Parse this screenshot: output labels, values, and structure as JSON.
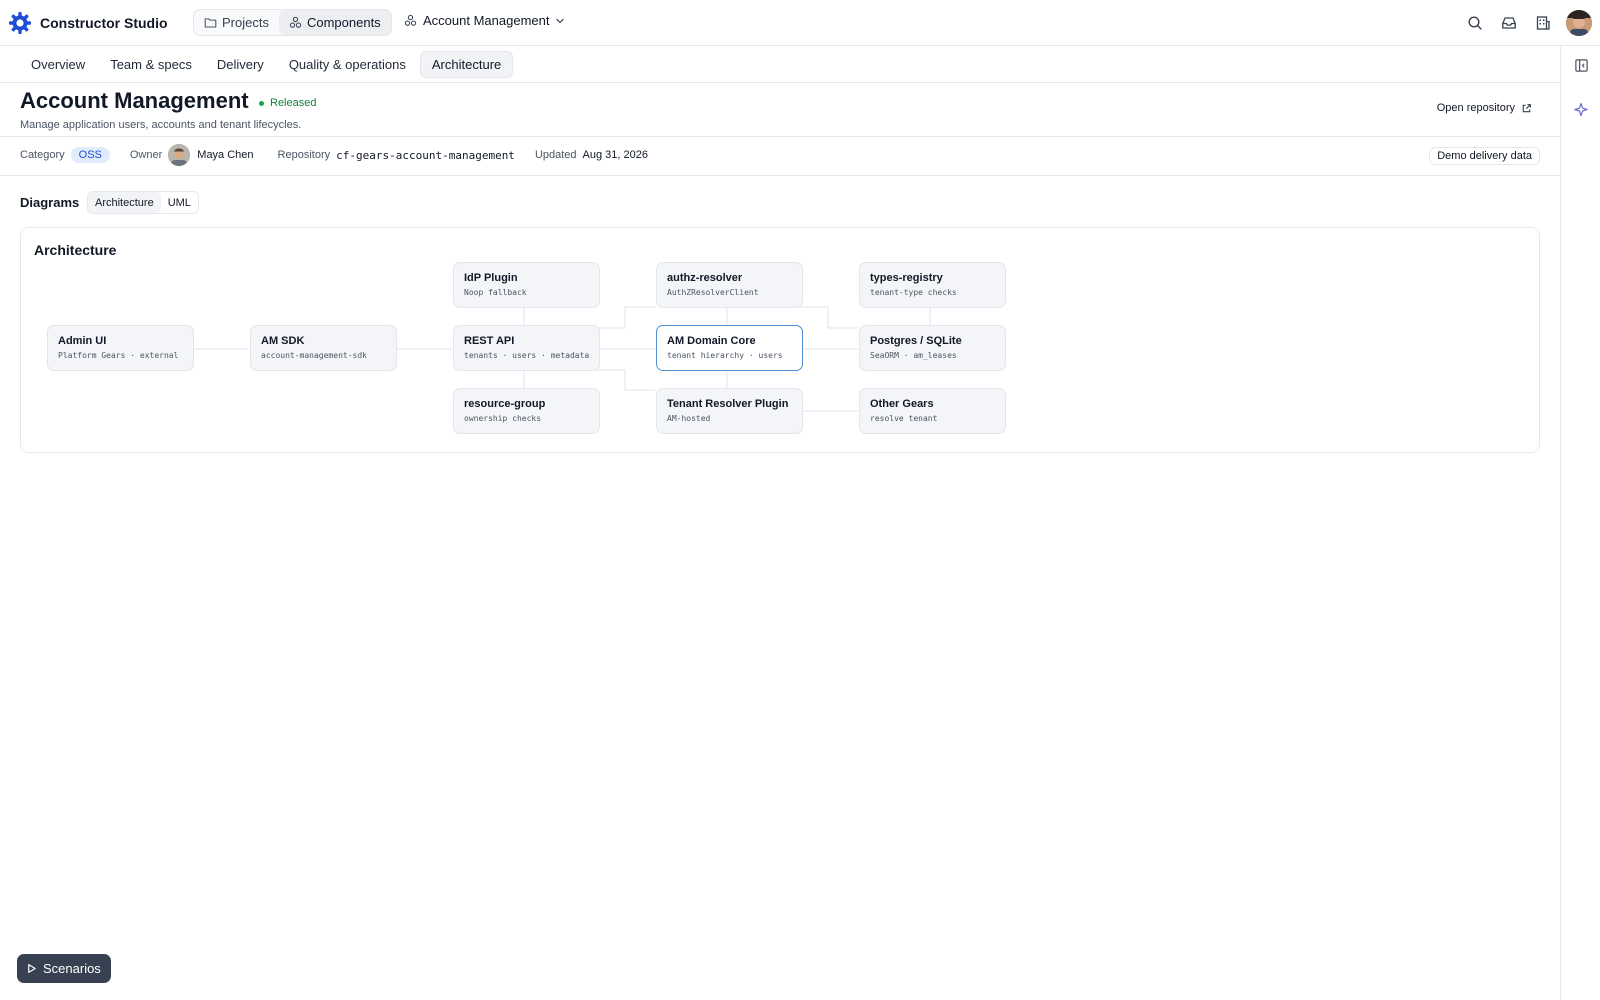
{
  "app": {
    "name": "Constructor Studio",
    "nav": [
      {
        "label": "Projects",
        "icon": "folder-icon",
        "active": false
      },
      {
        "label": "Components",
        "icon": "components-icon",
        "active": true
      }
    ],
    "breadcrumb": {
      "label": "Account Management",
      "icon": "components-icon"
    }
  },
  "tabs": [
    {
      "label": "Overview",
      "active": false
    },
    {
      "label": "Team & specs",
      "active": false
    },
    {
      "label": "Delivery",
      "active": false
    },
    {
      "label": "Quality & operations",
      "active": false
    },
    {
      "label": "Architecture",
      "active": true
    }
  ],
  "header": {
    "title": "Account Management",
    "status": "Released",
    "subtitle": "Manage application users, accounts and tenant lifecycles.",
    "open_repo": "Open repository"
  },
  "meta": {
    "category_label": "Category",
    "category_value": "OSS",
    "owner_label": "Owner",
    "owner_name": "Maya Chen",
    "repository_label": "Repository",
    "repository_value": "cf-gears-account-management",
    "updated_label": "Updated",
    "updated_value": "Aug 31, 2026",
    "demo_badge": "Demo delivery data"
  },
  "diagrams": {
    "label": "Diagrams",
    "options": [
      "Architecture",
      "UML"
    ],
    "selected": "Architecture"
  },
  "architecture": {
    "title": "Architecture",
    "nodes": {
      "admin_ui": {
        "title": "Admin UI",
        "sub": "Platform Gears · external"
      },
      "am_sdk": {
        "title": "AM SDK",
        "sub": "account-management-sdk"
      },
      "idp_plugin": {
        "title": "IdP Plugin",
        "sub": "Noop fallback"
      },
      "rest_api": {
        "title": "REST API",
        "sub": "tenants · users · metadata"
      },
      "resource_group": {
        "title": "resource-group",
        "sub": "ownership checks"
      },
      "authz_resolver": {
        "title": "authz-resolver",
        "sub": "AuthZResolverClient"
      },
      "am_domain_core": {
        "title": "AM Domain Core",
        "sub": "tenant hierarchy · users"
      },
      "tenant_resolver": {
        "title": "Tenant Resolver Plugin",
        "sub": "AM-hosted"
      },
      "types_registry": {
        "title": "types-registry",
        "sub": "tenant-type checks"
      },
      "postgres": {
        "title": "Postgres / SQLite",
        "sub": "SeaORM · am_leases"
      },
      "other_gears": {
        "title": "Other Gears",
        "sub": "resolve tenant"
      }
    }
  },
  "scenarios": {
    "label": "Scenarios"
  },
  "colors": {
    "accent": "#1d4ed8",
    "released": "#16a34a",
    "focus_border": "#4f8fd6",
    "scenarios_bg": "#374151"
  }
}
